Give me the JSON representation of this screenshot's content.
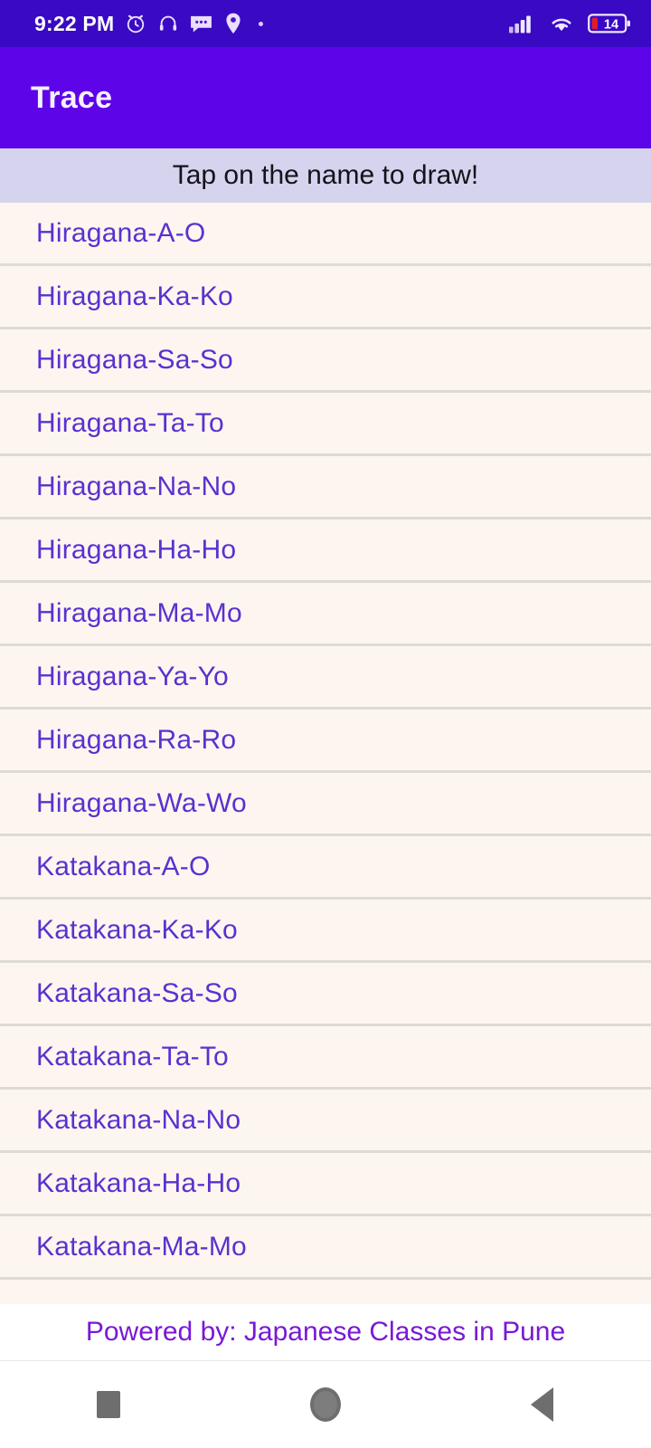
{
  "status_bar": {
    "time": "9:22 PM",
    "icons_left": [
      "alarm-icon",
      "headphones-icon",
      "message-icon",
      "location-pin-icon",
      "dot-indicator-icon"
    ],
    "icons_right": [
      "signal-icon",
      "wifi-icon",
      "battery-icon"
    ],
    "battery_level": "14",
    "background_color": "#3a09c3",
    "battery_fill_color": "#e01b2e"
  },
  "app_bar": {
    "title": "Trace",
    "background_color": "#5e04e8",
    "title_color": "#f4f0ff"
  },
  "hint_bar": {
    "text": "Tap on the name to draw!",
    "background_color": "#d6d3ee",
    "text_color": "#14121a"
  },
  "list": {
    "item_text_color": "#5a31cf",
    "background_color": "#fdf6f0",
    "divider_color": "#dedbd4",
    "items": [
      {
        "label": "Hiragana-A-O"
      },
      {
        "label": "Hiragana-Ka-Ko"
      },
      {
        "label": "Hiragana-Sa-So"
      },
      {
        "label": "Hiragana-Ta-To"
      },
      {
        "label": "Hiragana-Na-No"
      },
      {
        "label": "Hiragana-Ha-Ho"
      },
      {
        "label": "Hiragana-Ma-Mo"
      },
      {
        "label": "Hiragana-Ya-Yo"
      },
      {
        "label": "Hiragana-Ra-Ro"
      },
      {
        "label": "Hiragana-Wa-Wo"
      },
      {
        "label": "Katakana-A-O"
      },
      {
        "label": "Katakana-Ka-Ko"
      },
      {
        "label": "Katakana-Sa-So"
      },
      {
        "label": "Katakana-Ta-To"
      },
      {
        "label": "Katakana-Na-No"
      },
      {
        "label": "Katakana-Ha-Ho"
      },
      {
        "label": "Katakana-Ma-Mo"
      }
    ]
  },
  "footer": {
    "text": "Powered by: Japanese Classes in Pune",
    "text_color": "#7a18d6",
    "background_color": "#ffffff"
  },
  "nav_bar": {
    "buttons": [
      "recents-button",
      "home-button",
      "back-button"
    ],
    "icon_color": "#6e6e6e",
    "background_color": "#ffffff"
  }
}
